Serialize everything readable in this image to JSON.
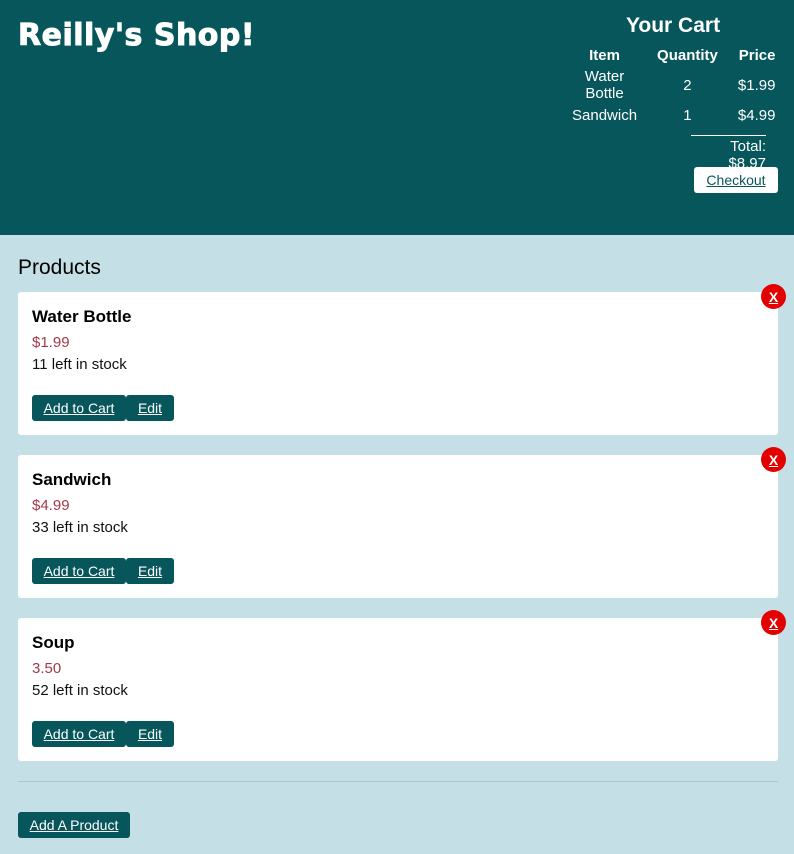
{
  "header": {
    "shop_title": "Reilly's Shop!"
  },
  "cart": {
    "title": "Your Cart",
    "columns": [
      "Item",
      "Quantity",
      "Price"
    ],
    "rows": [
      {
        "item": "Water Bottle",
        "quantity": "2",
        "price": "$1.99"
      },
      {
        "item": "Sandwich",
        "quantity": "1",
        "price": "$4.99"
      }
    ],
    "total": "Total: $8.97",
    "checkout_label": "Checkout"
  },
  "products": {
    "heading": "Products",
    "items": [
      {
        "name": "Water Bottle",
        "price": "$1.99",
        "stock": "11 left in stock"
      },
      {
        "name": "Sandwich",
        "price": "$4.99",
        "stock": "33 left in stock"
      },
      {
        "name": "Soup",
        "price": "3.50",
        "stock": "52 left in stock"
      }
    ],
    "add_to_cart_label": "Add to Cart",
    "edit_label": "Edit",
    "delete_label": "X",
    "add_product_label": "Add A Product"
  },
  "colors": {
    "header_bg": "#07565b",
    "page_bg": "#c4dfe5",
    "price_text": "#a33a4a",
    "delete_bg": "#e30000"
  }
}
